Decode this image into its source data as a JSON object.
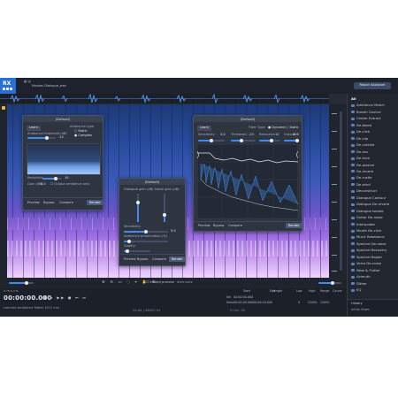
{
  "app": {
    "logo": "RX",
    "file_tab": "Nicolas Dialogue_wav",
    "repair_assistant": "Repair Assistant",
    "selected_file": "Learned Ambience Match (512 ms)"
  },
  "modules": [
    "All",
    "Ambience Match",
    "Breath Control",
    "Center Extract",
    "De-bleed",
    "De-click",
    "De-clip",
    "De-crackle",
    "De-ess",
    "De-hum",
    "De-plosive",
    "De-reverb",
    "De-rustle",
    "De-wind",
    "Deconstruct",
    "Dialogue Contour",
    "Dialogue De-reverb",
    "Dialogue Isolate",
    "Guitar De-noise",
    "Interpolate",
    "Mouth De-click",
    "Music Rebalance",
    "Spectral De-noise",
    "Spectral Recovery",
    "Spectral Repair",
    "Voice De-noise",
    "Wow & Flutter",
    "Azimuth",
    "Dither",
    "EQ"
  ],
  "history": {
    "label": "History",
    "entry": "Initial State"
  },
  "ambience_window": {
    "title": "(Default)",
    "tab_learn": "Learn",
    "ambience_threshold_label": "Ambience threshold (dB)",
    "ambience_threshold_value": "-12",
    "ambience_type": "Ambience type",
    "opt_static": "Static",
    "opt_complex": "Complex",
    "reduction_label": "Reduction",
    "reduction_value": "10",
    "gain_label": "Gain (dB)",
    "gain_value": "0.0",
    "output_ambience_only": "Output ambience only",
    "preview": "Preview",
    "bypass": "Bypass",
    "compare": "Compare",
    "render": "Render"
  },
  "dialogue_window": {
    "title": "(Default)",
    "dialogue_gain_label": "Dialogue gain (dB)",
    "noise_gain_label": "Noise gain (dB)",
    "sensitivity_label": "Sensitivity",
    "sensitivity_value": "5.0",
    "ambience_preservation_label": "Ambience preservation (%)",
    "quality_label": "Quality",
    "preview": "Preview",
    "bypass": "Bypass",
    "compare": "Compare",
    "render": "Render"
  },
  "denoise_window": {
    "title": "(Default)",
    "tab_learn": "Learn",
    "filter_type": "Filter Type:",
    "opt_dynamic": "Dynamic",
    "opt_static": "Static",
    "sensitivity_label": "Sensitivity",
    "sensitivity_value": "5.0",
    "threshold_label": "Threshold",
    "threshold_value": "-24",
    "reduction_label": "Reduction",
    "reduction_value": "12",
    "output_label": "Output",
    "output_value": "100",
    "preview": "Preview",
    "bypass": "Bypass",
    "compare": "Compare",
    "render": "Render"
  },
  "toolbar": {
    "instant_process": "Instant process",
    "attenuate": "Attenuate"
  },
  "transport": {
    "time": "00:00:00.000",
    "format_label": "h:m:s.ms"
  },
  "selection": {
    "headers": [
      "Start",
      "End",
      "Length",
      "Low",
      "High",
      "Range",
      "Cursor"
    ],
    "sel_label": "Sel",
    "view_label": "View",
    "sel_values": [
      "00:00:00.000",
      "",
      "",
      "",
      "",
      "",
      ""
    ],
    "view_values": [
      "00:00:00.000",
      "00:00:10.000",
      "",
      "0",
      "22050",
      "22050",
      ""
    ]
  },
  "status": {
    "sample_rate": "24-bit | 48000 Hz",
    "bit": "5 min. 45"
  }
}
